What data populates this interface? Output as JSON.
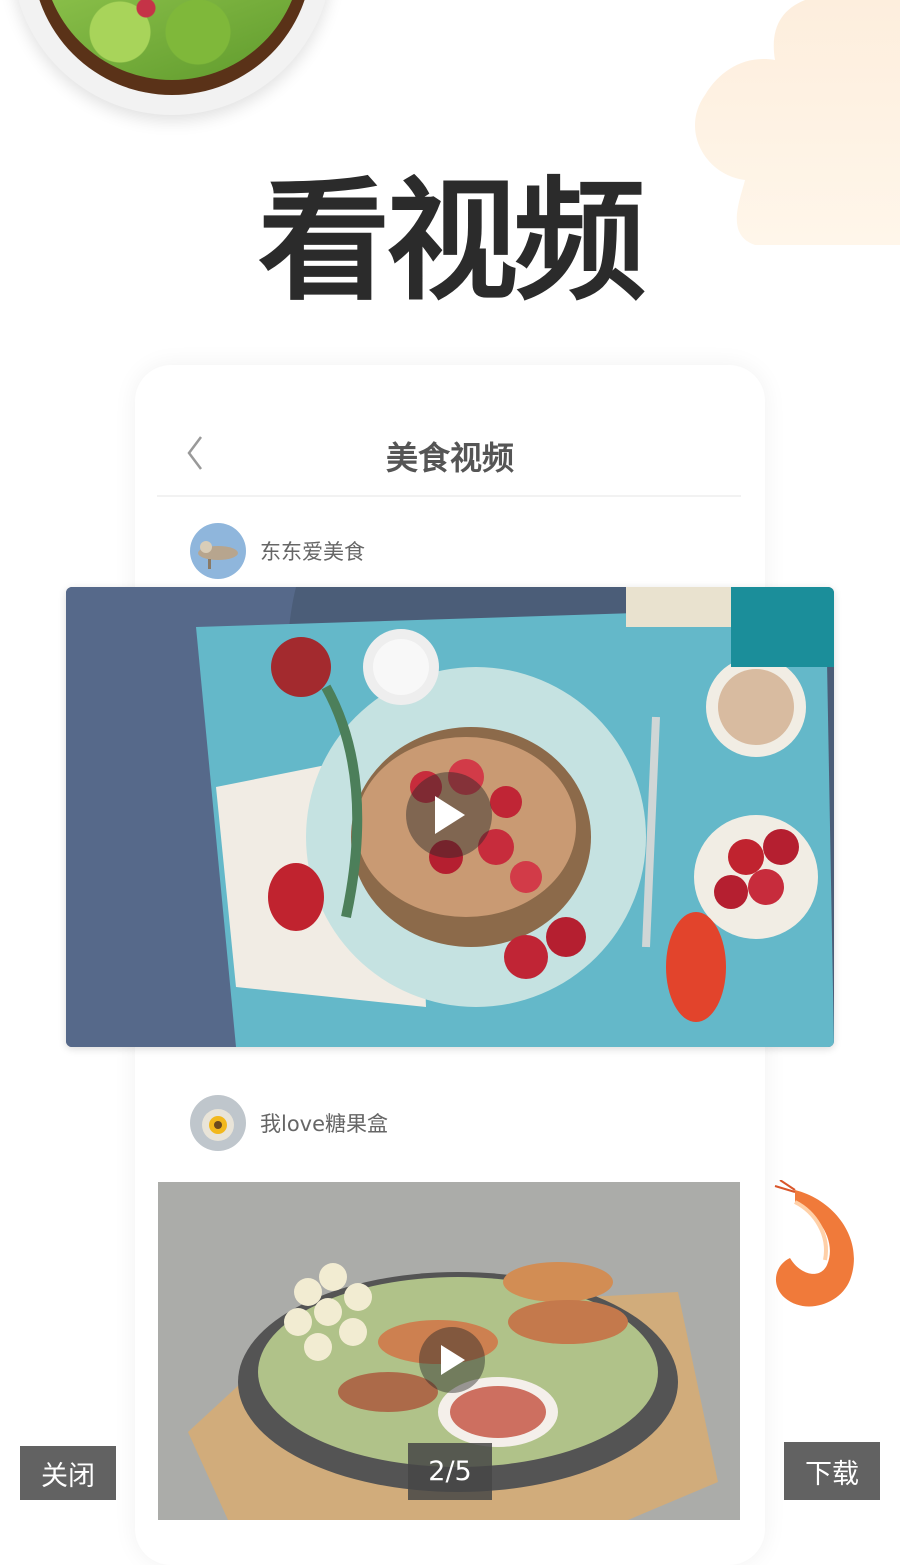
{
  "hero": {
    "title": "看视频"
  },
  "app": {
    "nav_title": "美食视频",
    "posts": [
      {
        "author": "东东爱美食"
      },
      {
        "author": "我love糖果盒"
      }
    ]
  },
  "viewer": {
    "close_label": "关闭",
    "page_indicator": "2/5",
    "download_label": "下载"
  },
  "icons": {
    "back": "chevron-left-icon",
    "play": "play-icon"
  },
  "colors": {
    "title": "#2b2b2b",
    "overlay_button": "#464646",
    "peach_accent": "#fdeedd"
  }
}
